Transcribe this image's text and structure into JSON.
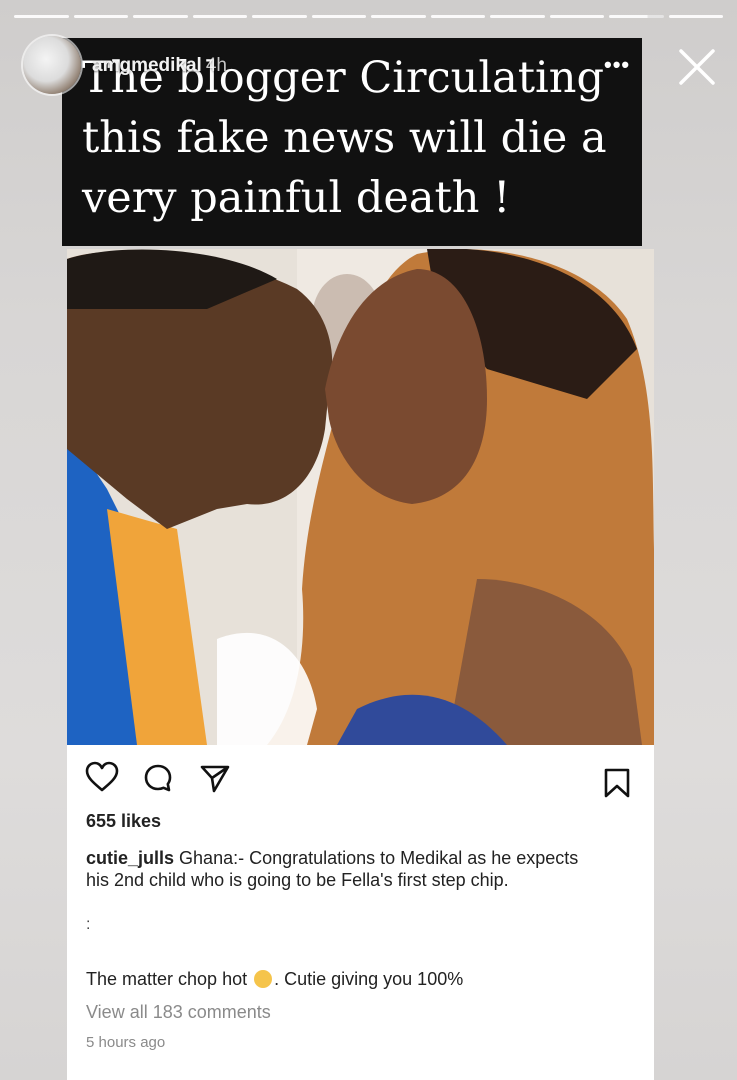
{
  "story": {
    "username": "amgmedikal",
    "time": "4h",
    "more": "•••",
    "caption_lines": [
      "The blogger Circulating",
      "this fake news will die a",
      "very painful death !"
    ],
    "progress_fraction_last": 0.7
  },
  "post": {
    "likes": "655 likes",
    "caption_user": "cutie_julls",
    "caption_text": "Ghana:- Congratulations to Medikal as he expects his 2nd child who is going to be Fella's first step chip.",
    "dots": ":",
    "comment_before": "The matter chop hot",
    "comment_after": ". Cutie giving you 100%",
    "view_all": "View all 183 comments",
    "time_ago": "5 hours ago"
  },
  "colors": {
    "caption_bg": "#111111",
    "caption_text": "#ffffff",
    "link_gray": "#8a8a8a"
  },
  "icons": [
    "heart-icon",
    "comment-icon",
    "share-icon",
    "bookmark-icon",
    "close-icon",
    "more-icon"
  ]
}
